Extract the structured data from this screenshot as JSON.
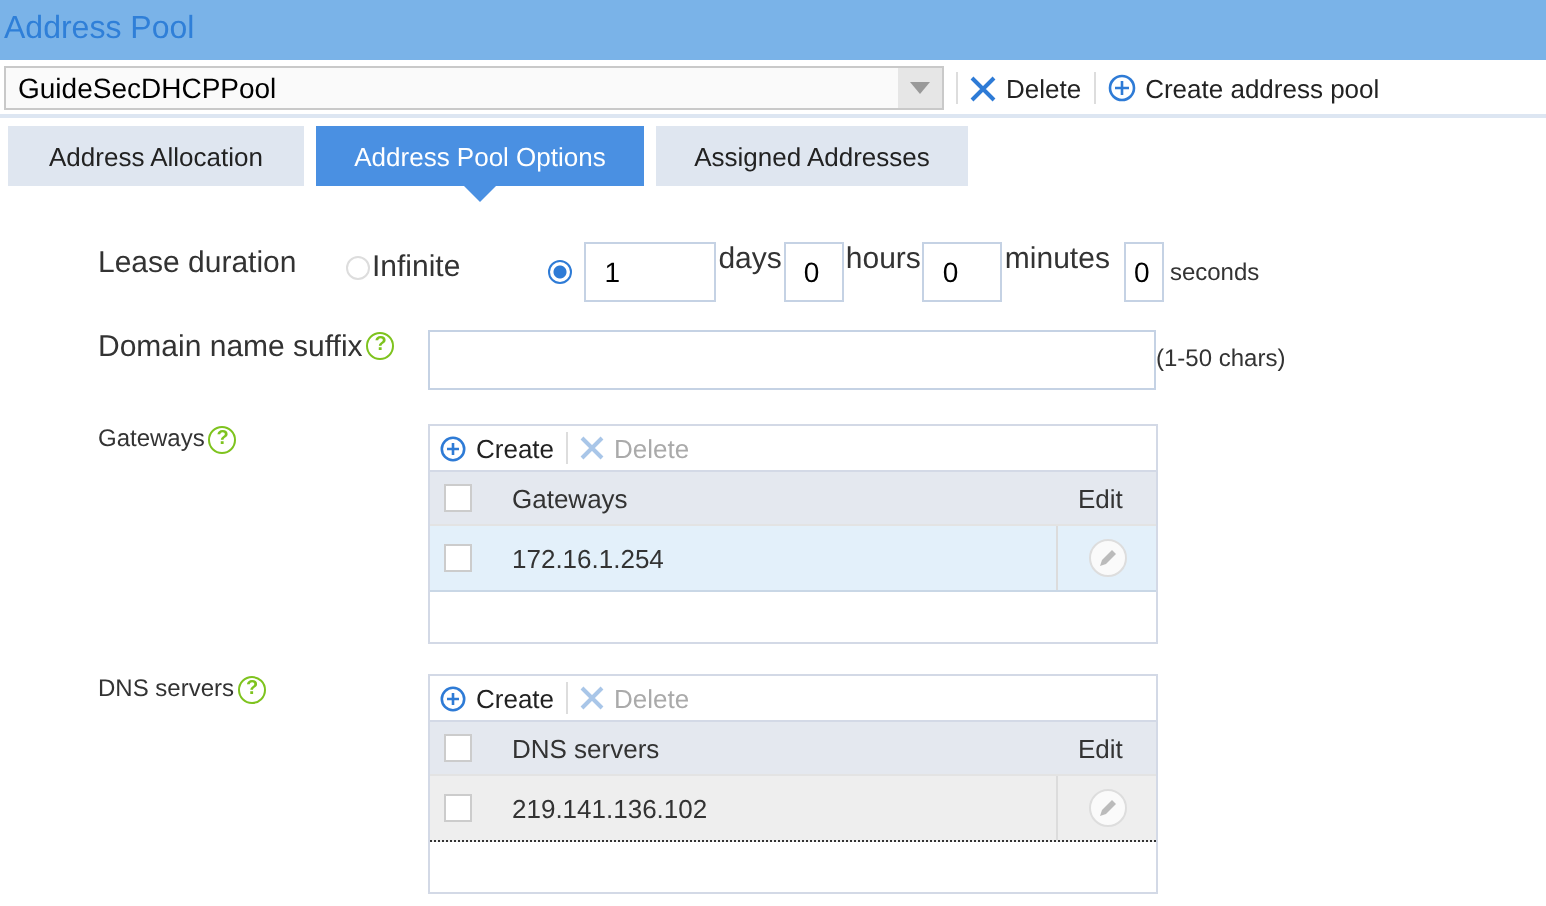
{
  "window": {
    "title": "Address Pool"
  },
  "toolbar": {
    "pool_select": {
      "value": "GuideSecDHCPPool"
    },
    "buttons": [
      {
        "label": "Delete",
        "kind": "delete"
      },
      {
        "label": "Create address pool",
        "kind": "create"
      }
    ]
  },
  "tabs": [
    {
      "label": "Address Allocation",
      "selected": false
    },
    {
      "label": "Address Pool Options",
      "selected": true
    },
    {
      "label": "Assigned Addresses",
      "selected": false
    }
  ],
  "lease": {
    "label": "Lease duration",
    "infinite": {
      "label": "Infinite",
      "selected": false
    },
    "custom_selected": true,
    "fields": [
      {
        "value": "1",
        "unit": "days"
      },
      {
        "value": "0",
        "unit": "hours"
      },
      {
        "value": "0",
        "unit": "minutes"
      },
      {
        "value": "0",
        "unit": "seconds"
      }
    ]
  },
  "domain": {
    "label": "Domain name suffix",
    "help": "?",
    "hint": "(1-50 chars)"
  },
  "lists": [
    {
      "label": "Gateways",
      "help": "?",
      "create": "Create",
      "delete": "Delete",
      "delete_disabled": true,
      "all_checked": false,
      "column": "Gateways",
      "edit": "Edit",
      "rows": [
        {
          "value": "172.16.1.254",
          "checked": false,
          "selected": true,
          "focused": false
        }
      ]
    },
    {
      "label": "DNS servers",
      "help": "?",
      "create": "Create",
      "delete": "Delete",
      "delete_disabled": true,
      "all_checked": false,
      "column": "DNS servers",
      "edit": "Edit",
      "rows": [
        {
          "value": "219.141.136.102",
          "checked": false,
          "selected": false,
          "focused": true
        }
      ]
    }
  ]
}
